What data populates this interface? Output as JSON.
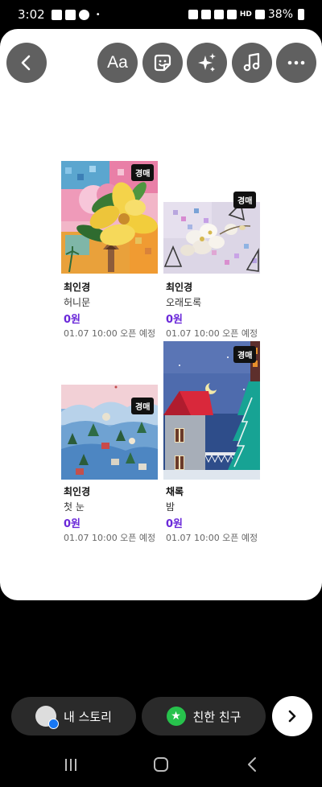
{
  "status_bar": {
    "time": "3:02",
    "dot": "•",
    "network": "HD",
    "battery": "38%"
  },
  "toolbar": {
    "back_icon": "chevron-left-icon",
    "text_icon": "text-aa-icon",
    "text_label": "Aa",
    "sticker_icon": "sticker-icon",
    "effects_icon": "sparkle-icon",
    "music_icon": "music-note-icon",
    "more_icon": "more-horizontal-icon"
  },
  "products": [
    {
      "badge": "경매",
      "artist": "최인경",
      "title": "허니문",
      "price": "0원",
      "open": "01.07 10:00 오픈 예정"
    },
    {
      "badge": "경매",
      "artist": "최인경",
      "title": "오래도록",
      "price": "0원",
      "open": "01.07 10:00 오픈 예정"
    },
    {
      "badge": "경매",
      "artist": "최인경",
      "title": "첫 눈",
      "price": "0원",
      "open": "01.07 10:00 오픈 예정"
    },
    {
      "badge": "경매",
      "artist": "채록",
      "title": "밤",
      "price": "0원",
      "open": "01.07 10:00 오픈 예정"
    }
  ],
  "share_bar": {
    "my_story": "내 스토리",
    "close_friends": "친한 친구",
    "next_icon": "chevron-right-icon"
  },
  "nav_bar": {
    "recents_icon": "recents-icon",
    "home_icon": "home-icon",
    "back_icon": "back-icon"
  },
  "colors": {
    "price": "#6a28d9",
    "badge_bg": "#111111",
    "toolbar_button": "#606060",
    "close_friends_star": "#27c24c"
  }
}
